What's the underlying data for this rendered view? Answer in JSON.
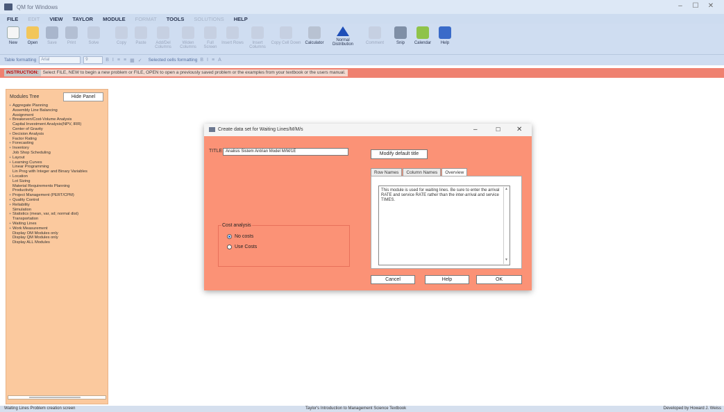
{
  "window": {
    "title": "QM for Windows",
    "controls": [
      "–",
      "☐",
      "✕"
    ]
  },
  "menu": [
    {
      "label": "FILE",
      "enabled": true
    },
    {
      "label": "EDIT",
      "enabled": false
    },
    {
      "label": "VIEW",
      "enabled": true
    },
    {
      "label": "TAYLOR",
      "enabled": true
    },
    {
      "label": "MODULE",
      "enabled": true
    },
    {
      "label": "FORMAT",
      "enabled": false
    },
    {
      "label": "TOOLS",
      "enabled": true
    },
    {
      "label": "SOLUTIONS",
      "enabled": false
    },
    {
      "label": "HELP",
      "enabled": true
    }
  ],
  "toolbar": {
    "new": "New",
    "open": "Open",
    "save": "Save",
    "print": "Print",
    "solve": "Solve",
    "copy": "Copy",
    "paste": "Paste",
    "add_col": "Add/Del Columns",
    "widen": "Widen Columns",
    "full_screen": "Full Screen",
    "insert_rows": "Insert Rows",
    "insert_cols": "Insert Columns",
    "copy_cell": "Copy Cell Down",
    "calculator": "Calculator",
    "normal": "Normal Distribution",
    "comment": "Comment",
    "snip": "Snip",
    "calendar": "Calendar",
    "help": "Help"
  },
  "format_bar": {
    "label": "Table formatting",
    "font": "Arial",
    "size": "9",
    "selected": "Selected cells formatting"
  },
  "instruction": {
    "tag": "INSTRUCTION:",
    "message": "Select FILE, NEW to begin a new problem or FILE, OPEN to open a previously saved problem or the examples from your textbook or the users manual."
  },
  "sidebar": {
    "title": "Modules Tree",
    "hide_button": "Hide Panel",
    "items": [
      {
        "label": "Aggregate Planning",
        "exp": "+"
      },
      {
        "label": "Assembly Line Balancing",
        "exp": ""
      },
      {
        "label": "Assignment",
        "exp": ""
      },
      {
        "label": "Breakeven/Cost-Volume Analysis",
        "exp": "+"
      },
      {
        "label": "Capital Investment Analysis(NPV, IRR)",
        "exp": ""
      },
      {
        "label": "Center of Gravity",
        "exp": ""
      },
      {
        "label": "Decision Analysis",
        "exp": "+"
      },
      {
        "label": "Factor Rating",
        "exp": ""
      },
      {
        "label": "Forecasting",
        "exp": "+"
      },
      {
        "label": "Inventory",
        "exp": "+"
      },
      {
        "label": "Job Shop Scheduling",
        "exp": ""
      },
      {
        "label": "Layout",
        "exp": "+"
      },
      {
        "label": "Learning Curves",
        "exp": "+"
      },
      {
        "label": "Linear Programming",
        "exp": ""
      },
      {
        "label": "Lin Prog with Integer and Binary Variables",
        "exp": ""
      },
      {
        "label": "Location",
        "exp": "+"
      },
      {
        "label": "Lot Sizing",
        "exp": ""
      },
      {
        "label": "Material Requirements Planning",
        "exp": ""
      },
      {
        "label": "Productivity",
        "exp": ""
      },
      {
        "label": "Project Management (PERT/CPM)",
        "exp": "+"
      },
      {
        "label": "Quality Control",
        "exp": "+"
      },
      {
        "label": "Reliability",
        "exp": "+"
      },
      {
        "label": "Simulation",
        "exp": ""
      },
      {
        "label": "Statistics (mean, var, sd; normal dist)",
        "exp": "+"
      },
      {
        "label": "Transportation",
        "exp": ""
      },
      {
        "label": "Waiting Lines",
        "exp": "+"
      },
      {
        "label": "Work Measurement",
        "exp": "+"
      },
      {
        "label": "Display OM Modules only",
        "exp": ""
      },
      {
        "label": "Display QM Modules only",
        "exp": ""
      },
      {
        "label": "Display ALL Modules",
        "exp": ""
      }
    ]
  },
  "dialog": {
    "title": "Create data set for Waiting Lines/M/M/s",
    "title_label": "TITLE",
    "title_value": "Analisis Sistem Antrian Model M/M/1E",
    "modify_button": "Modify default title",
    "tabs": [
      "Row Names",
      "Column Names",
      "Overview"
    ],
    "active_tab": "Overview",
    "overview_text": "This module is used for waiting lines. Be sure to enter the arrival RATE and service RATE rather than the inter-arrival and service TIMES.",
    "cost_group": "Cost analysis",
    "radios": [
      {
        "label": "No costs",
        "checked": true
      },
      {
        "label": "Use Costs",
        "checked": false
      }
    ],
    "cancel": "Cancel",
    "help": "Help",
    "ok": "OK"
  },
  "status": {
    "left": "Waiting Lines   Problem creation screen",
    "center": "Taylor's Introduction to Management Science Textbook",
    "right": "Developed by Howard J. Weiss"
  },
  "colors": {
    "instruction_bar": "#ef8170",
    "sidebar": "#fbc99e",
    "dialog": "#fb9276",
    "chrome": "#cfddf1"
  }
}
